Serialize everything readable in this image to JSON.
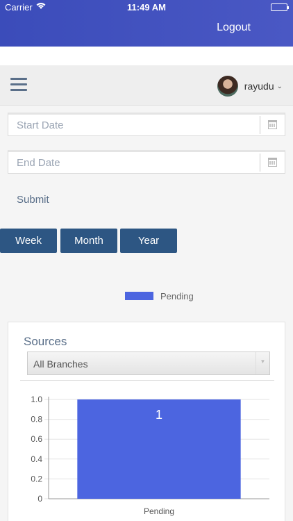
{
  "status_bar": {
    "carrier": "Carrier",
    "time": "11:49 AM"
  },
  "header": {
    "logout_label": "Logout"
  },
  "navbar": {
    "username": "rayudu"
  },
  "filters": {
    "start_date_placeholder": "Start Date",
    "end_date_placeholder": "End Date",
    "submit_label": "Submit"
  },
  "periods": [
    "Week",
    "Month",
    "Year"
  ],
  "legend": {
    "label": "Pending",
    "color": "#4c65e0"
  },
  "sources_card": {
    "title": "Sources",
    "branch_selected": "All Branches"
  },
  "colors": {
    "header": "#3b4cba",
    "period_button": "#2d5683",
    "bar": "#4c65e0"
  },
  "chart_data": {
    "type": "bar",
    "categories": [
      "Pending"
    ],
    "series": [
      {
        "name": "Pending",
        "values": [
          1
        ]
      }
    ],
    "data_labels": [
      "1"
    ],
    "ylim": [
      0,
      1.0
    ],
    "yticks": [
      "0",
      "0.2",
      "0.4",
      "0.6",
      "0.8",
      "1.0"
    ],
    "grid": true
  }
}
